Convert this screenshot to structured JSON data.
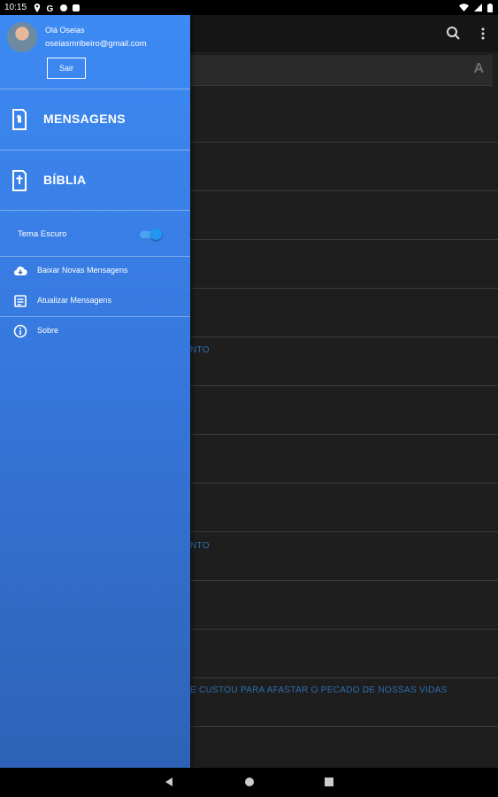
{
  "status_bar": {
    "time": "10:15"
  },
  "background": {
    "row_texts": [
      {
        "row": 5,
        "text": "NTO"
      },
      {
        "row": 12,
        "text": "E CUSTOU PARA AFASTAR O PECADO DE NOSSAS VIDAS"
      }
    ]
  },
  "drawer": {
    "user": {
      "greeting": "Olá Oseias",
      "email": "oseiasmribeiro@gmail.com",
      "logout_label": "Sair"
    },
    "main_items": [
      {
        "label": "MENSAGENS",
        "icon": "book-hand-icon"
      },
      {
        "label": "BÍBLIA",
        "icon": "bible-icon"
      }
    ],
    "theme": {
      "label": "Tema Escuro",
      "enabled": true
    },
    "menu_items": [
      {
        "label": "Baixar Novas Mensagens",
        "icon": "cloud-download-icon"
      },
      {
        "label": "Atualizar Mensagens",
        "icon": "update-list-icon"
      },
      {
        "label": "Sobre",
        "icon": "info-icon"
      }
    ]
  },
  "colors": {
    "drawer_top": "#3d8af3",
    "drawer_bottom": "#2e62b6",
    "accent": "#2196f3",
    "background": "#1e1e1e"
  }
}
